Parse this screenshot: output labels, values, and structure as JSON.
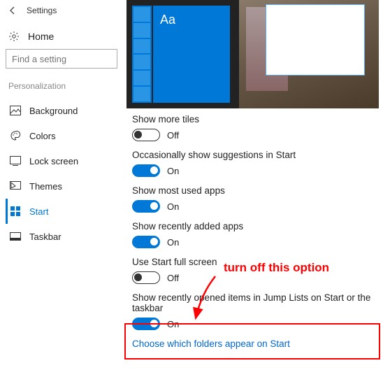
{
  "titlebar": {
    "title": "Settings"
  },
  "sidebar": {
    "home_label": "Home",
    "search_placeholder": "Find a setting",
    "section": "Personalization",
    "items": [
      {
        "label": "Background"
      },
      {
        "label": "Colors"
      },
      {
        "label": "Lock screen"
      },
      {
        "label": "Themes"
      },
      {
        "label": "Start"
      },
      {
        "label": "Taskbar"
      }
    ]
  },
  "preview": {
    "tile_text": "Aa"
  },
  "settings": [
    {
      "label": "Show more tiles",
      "state": "Off",
      "on": false
    },
    {
      "label": "Occasionally show suggestions in Start",
      "state": "On",
      "on": true
    },
    {
      "label": "Show most used apps",
      "state": "On",
      "on": true
    },
    {
      "label": "Show recently added apps",
      "state": "On",
      "on": true
    },
    {
      "label": "Use Start full screen",
      "state": "Off",
      "on": false
    },
    {
      "label": "Show recently opened items in Jump Lists on Start or the taskbar",
      "state": "On",
      "on": true
    }
  ],
  "link": "Choose which folders appear on Start",
  "annotation": "turn off this option"
}
